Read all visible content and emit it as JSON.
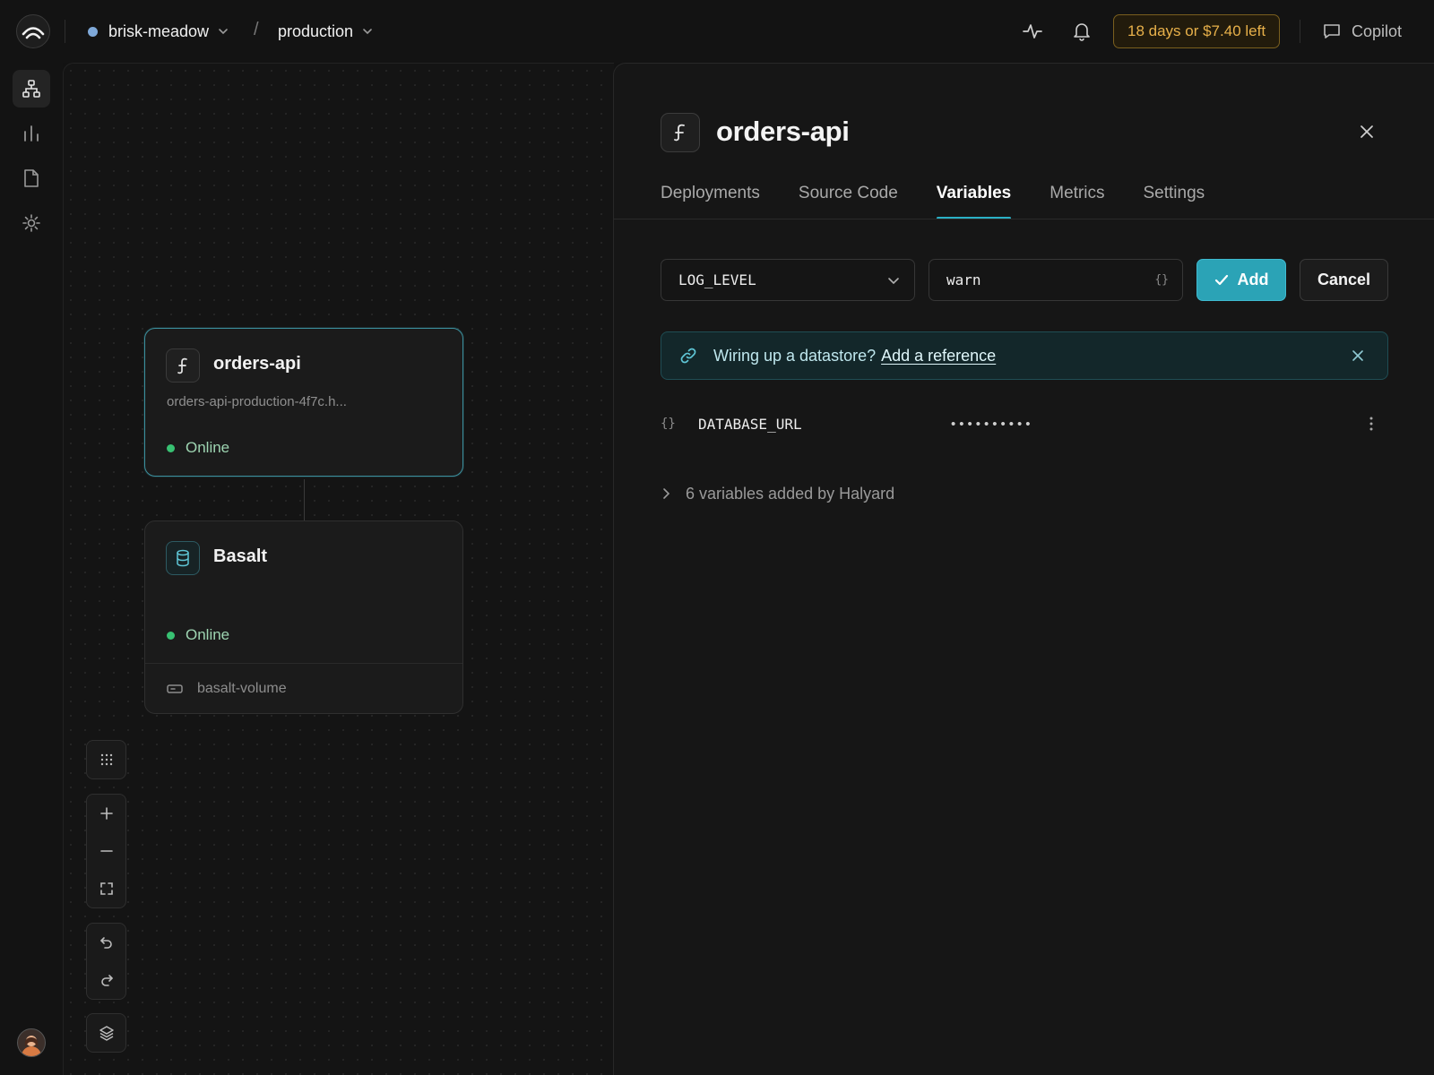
{
  "topbar": {
    "project_name": "brisk-meadow",
    "breadcrumb_separator": "/",
    "environment": "production",
    "trial_badge": "18 days or $7.40 left",
    "copilot_label": "Copilot",
    "project_status_color": "#7fa9d9",
    "icons": [
      "activity-icon",
      "bell-icon",
      "chat-icon"
    ]
  },
  "rail": {
    "items": [
      "architecture-icon",
      "metrics-icon",
      "docs-icon",
      "settings-icon"
    ],
    "active": "architecture-icon"
  },
  "canvas": {
    "services": [
      {
        "name": "orders-api",
        "icon": "function-icon",
        "url": "orders-api-production-4f7c.h...",
        "status": "Online",
        "selected": true
      },
      {
        "name": "Basalt",
        "icon": "database-icon",
        "status": "Online",
        "volume": "basalt-volume",
        "selected": false
      }
    ],
    "tools": [
      "grid-icon",
      "zoom-in-icon",
      "zoom-out-icon",
      "fit-icon",
      "undo-icon",
      "redo-icon",
      "layers-icon"
    ]
  },
  "panel": {
    "title": "orders-api",
    "tabs": [
      {
        "label": "Deployments",
        "active": false
      },
      {
        "label": "Source Code",
        "active": false
      },
      {
        "label": "Variables",
        "active": true
      },
      {
        "label": "Metrics",
        "active": false
      },
      {
        "label": "Settings",
        "active": false
      }
    ],
    "new_variable": {
      "name": "LOG_LEVEL",
      "value": "warn"
    },
    "add_button": "Add",
    "cancel_button": "Cancel",
    "banner": {
      "text": "Wiring up a datastore?",
      "link": "Add a reference"
    },
    "variables": [
      {
        "name": "DATABASE_URL",
        "value": "••••••••••",
        "type_icon": "{}"
      }
    ],
    "collapsed_group": "6 variables added by Halyard"
  },
  "colors": {
    "accent": "#2ba3b6",
    "online": "#38c172",
    "trial": "#e7b04a"
  }
}
